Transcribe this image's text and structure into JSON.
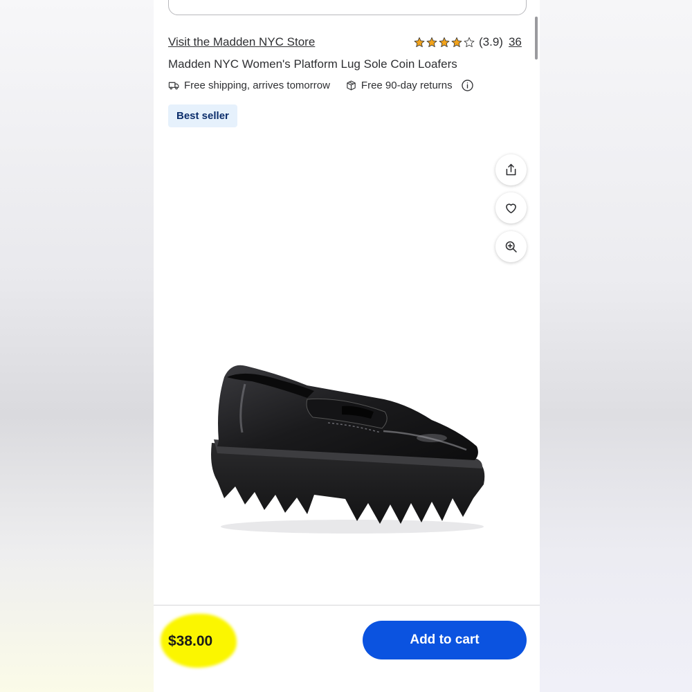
{
  "product": {
    "store_link": "Visit the Madden NYC Store",
    "rating_value": 3.9,
    "rating_text": "(3.9)",
    "review_count": "36",
    "title": "Madden NYC Women's Platform Lug Sole Coin Loafers",
    "shipping": "Free shipping, arrives tomorrow",
    "returns": "Free 90-day returns",
    "badge": "Best seller"
  },
  "actions": {
    "share_icon": "share-icon",
    "favorite_icon": "heart-icon",
    "zoom_icon": "zoom-in-icon"
  },
  "footer": {
    "price": "$38.00",
    "add_to_cart": "Add to cart"
  },
  "colors": {
    "star": "#f2a31b",
    "badge_bg": "#e6f1fc",
    "badge_text": "#0b2d6b",
    "cart_button": "#0b53e0",
    "price_highlight": "#fbf600"
  }
}
